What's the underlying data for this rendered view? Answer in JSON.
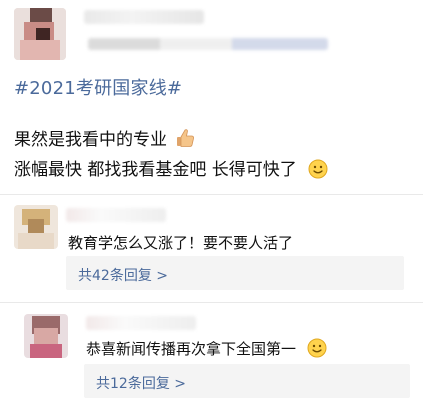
{
  "post": {
    "hashtag": "#2021考研国家线#",
    "line1": "果然是我看中的专业",
    "line1_emoji": "thumbs-up-icon",
    "line2": "涨幅最快  都找我看基金吧  长得可快了",
    "line2_emoji": "smiling-face-icon"
  },
  "comments": [
    {
      "text": "教育学怎么又涨了！要不要人活了",
      "reply_link": "共42条回复 >"
    },
    {
      "text": "恭喜新闻传播再次拿下全国第一",
      "text_emoji": "smiling-face-icon",
      "reply_link": "共12条回复 >"
    }
  ],
  "colors": {
    "link_blue": "#4b6a9b",
    "reply_bg": "#f4f4f4",
    "text": "#111111"
  }
}
